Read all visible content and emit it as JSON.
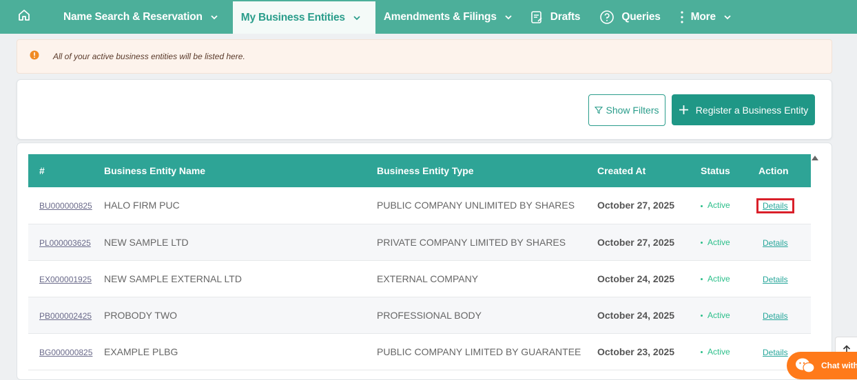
{
  "nav": {
    "items": [
      {
        "label": "Name Search & Reservation"
      },
      {
        "label": "My Business Entities"
      },
      {
        "label": "Amendments & Filings"
      },
      {
        "label": "Drafts"
      },
      {
        "label": "Queries"
      },
      {
        "label": "More"
      }
    ]
  },
  "alert": {
    "text": "All of your active business entities will be listed here."
  },
  "actions": {
    "show_filters": "Show Filters",
    "register": "Register a Business Entity"
  },
  "table": {
    "headers": [
      "#",
      "Business Entity Name",
      "Business Entity Type",
      "Created At",
      "Status",
      "Action"
    ],
    "rows": [
      {
        "id": "BU000000825",
        "name": "HALO FIRM PUC",
        "type": "PUBLIC COMPANY UNLIMITED BY SHARES",
        "created": "October 27, 2025",
        "status": "Active",
        "action": "Details"
      },
      {
        "id": "PL000003625",
        "name": "NEW SAMPLE LTD",
        "type": "PRIVATE COMPANY LIMITED BY SHARES",
        "created": "October 27, 2025",
        "status": "Active",
        "action": "Details"
      },
      {
        "id": "EX000001925",
        "name": "NEW SAMPLE EXTERNAL LTD",
        "type": "EXTERNAL COMPANY",
        "created": "October 24, 2025",
        "status": "Active",
        "action": "Details"
      },
      {
        "id": "PB000002425",
        "name": "PROBODY TWO",
        "type": "PROFESSIONAL BODY",
        "created": "October 24, 2025",
        "status": "Active",
        "action": "Details"
      },
      {
        "id": "BG000000825",
        "name": "EXAMPLE PLBG",
        "type": "PUBLIC COMPANY LIMITED BY GUARANTEE",
        "created": "October 23, 2025",
        "status": "Active",
        "action": "Details"
      }
    ]
  },
  "chat": {
    "label": "Chat with"
  },
  "colors": {
    "nav": "#4caf9a",
    "accent": "#1f9786",
    "header": "#2ea496",
    "status": "#2bbf8a",
    "highlight": "#d9202a",
    "chat": "#ff7a1a"
  }
}
